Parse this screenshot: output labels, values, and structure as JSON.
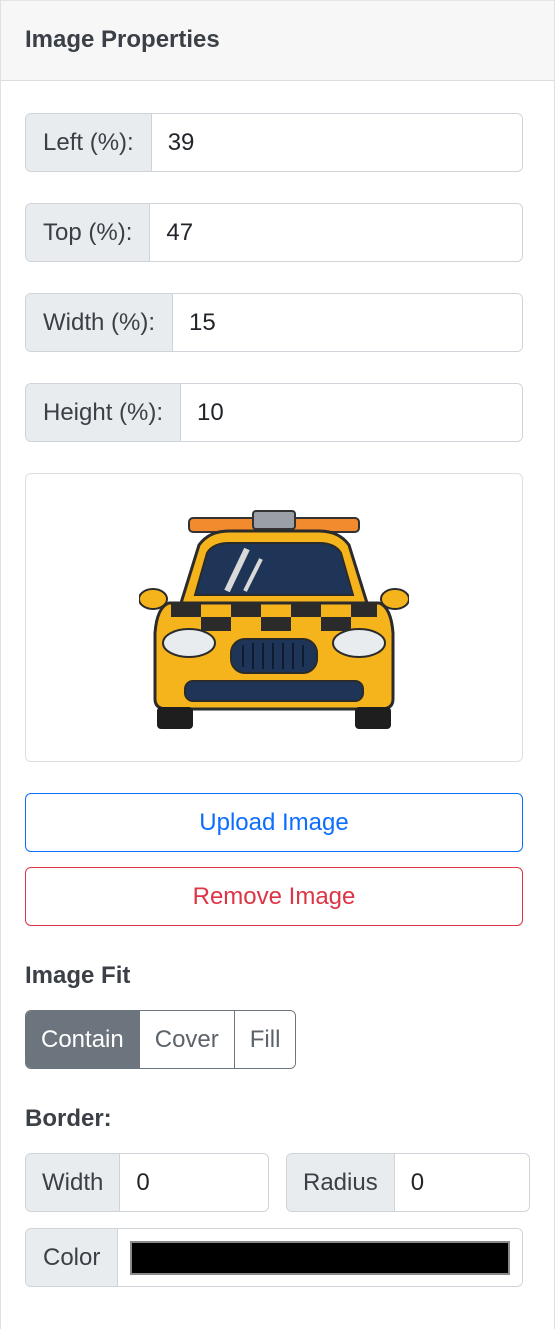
{
  "header": {
    "title": "Image Properties"
  },
  "position": {
    "left": {
      "label": "Left (%):",
      "value": "39"
    },
    "top": {
      "label": "Top (%):",
      "value": "47"
    },
    "width": {
      "label": "Width (%):",
      "value": "15"
    },
    "height": {
      "label": "Height (%):",
      "value": "10"
    }
  },
  "preview": {
    "icon": "taxi-car-icon"
  },
  "actions": {
    "upload_label": "Upload Image",
    "remove_label": "Remove Image"
  },
  "image_fit": {
    "label": "Image Fit",
    "options": [
      "Contain",
      "Cover",
      "Fill"
    ],
    "selected": "Contain"
  },
  "border": {
    "label": "Border:",
    "width": {
      "label": "Width",
      "value": "0"
    },
    "radius": {
      "label": "Radius",
      "value": "0"
    },
    "color": {
      "label": "Color",
      "value": "#000000"
    }
  },
  "colors": {
    "primary": "#0d6efd",
    "danger": "#dc3545",
    "secondary": "#6c757d",
    "taxi_yellow": "#f5b41c"
  }
}
